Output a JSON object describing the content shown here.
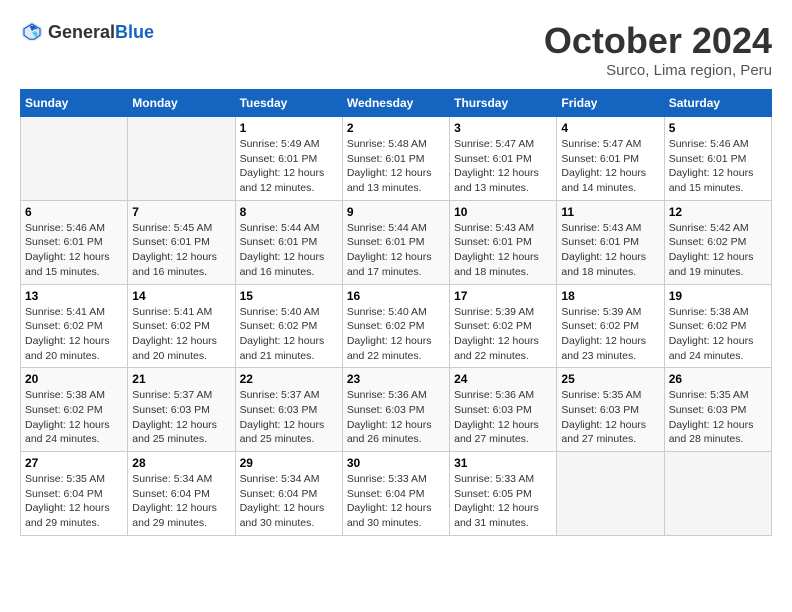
{
  "header": {
    "logo_general": "General",
    "logo_blue": "Blue",
    "month_title": "October 2024",
    "location": "Surco, Lima region, Peru"
  },
  "days_of_week": [
    "Sunday",
    "Monday",
    "Tuesday",
    "Wednesday",
    "Thursday",
    "Friday",
    "Saturday"
  ],
  "weeks": [
    [
      {
        "day": "",
        "info": ""
      },
      {
        "day": "",
        "info": ""
      },
      {
        "day": "1",
        "sunrise": "5:49 AM",
        "sunset": "6:01 PM",
        "daylight": "12 hours and 12 minutes."
      },
      {
        "day": "2",
        "sunrise": "5:48 AM",
        "sunset": "6:01 PM",
        "daylight": "12 hours and 13 minutes."
      },
      {
        "day": "3",
        "sunrise": "5:47 AM",
        "sunset": "6:01 PM",
        "daylight": "12 hours and 13 minutes."
      },
      {
        "day": "4",
        "sunrise": "5:47 AM",
        "sunset": "6:01 PM",
        "daylight": "12 hours and 14 minutes."
      },
      {
        "day": "5",
        "sunrise": "5:46 AM",
        "sunset": "6:01 PM",
        "daylight": "12 hours and 15 minutes."
      }
    ],
    [
      {
        "day": "6",
        "sunrise": "5:46 AM",
        "sunset": "6:01 PM",
        "daylight": "12 hours and 15 minutes."
      },
      {
        "day": "7",
        "sunrise": "5:45 AM",
        "sunset": "6:01 PM",
        "daylight": "12 hours and 16 minutes."
      },
      {
        "day": "8",
        "sunrise": "5:44 AM",
        "sunset": "6:01 PM",
        "daylight": "12 hours and 16 minutes."
      },
      {
        "day": "9",
        "sunrise": "5:44 AM",
        "sunset": "6:01 PM",
        "daylight": "12 hours and 17 minutes."
      },
      {
        "day": "10",
        "sunrise": "5:43 AM",
        "sunset": "6:01 PM",
        "daylight": "12 hours and 18 minutes."
      },
      {
        "day": "11",
        "sunrise": "5:43 AM",
        "sunset": "6:01 PM",
        "daylight": "12 hours and 18 minutes."
      },
      {
        "day": "12",
        "sunrise": "5:42 AM",
        "sunset": "6:02 PM",
        "daylight": "12 hours and 19 minutes."
      }
    ],
    [
      {
        "day": "13",
        "sunrise": "5:41 AM",
        "sunset": "6:02 PM",
        "daylight": "12 hours and 20 minutes."
      },
      {
        "day": "14",
        "sunrise": "5:41 AM",
        "sunset": "6:02 PM",
        "daylight": "12 hours and 20 minutes."
      },
      {
        "day": "15",
        "sunrise": "5:40 AM",
        "sunset": "6:02 PM",
        "daylight": "12 hours and 21 minutes."
      },
      {
        "day": "16",
        "sunrise": "5:40 AM",
        "sunset": "6:02 PM",
        "daylight": "12 hours and 22 minutes."
      },
      {
        "day": "17",
        "sunrise": "5:39 AM",
        "sunset": "6:02 PM",
        "daylight": "12 hours and 22 minutes."
      },
      {
        "day": "18",
        "sunrise": "5:39 AM",
        "sunset": "6:02 PM",
        "daylight": "12 hours and 23 minutes."
      },
      {
        "day": "19",
        "sunrise": "5:38 AM",
        "sunset": "6:02 PM",
        "daylight": "12 hours and 24 minutes."
      }
    ],
    [
      {
        "day": "20",
        "sunrise": "5:38 AM",
        "sunset": "6:02 PM",
        "daylight": "12 hours and 24 minutes."
      },
      {
        "day": "21",
        "sunrise": "5:37 AM",
        "sunset": "6:03 PM",
        "daylight": "12 hours and 25 minutes."
      },
      {
        "day": "22",
        "sunrise": "5:37 AM",
        "sunset": "6:03 PM",
        "daylight": "12 hours and 25 minutes."
      },
      {
        "day": "23",
        "sunrise": "5:36 AM",
        "sunset": "6:03 PM",
        "daylight": "12 hours and 26 minutes."
      },
      {
        "day": "24",
        "sunrise": "5:36 AM",
        "sunset": "6:03 PM",
        "daylight": "12 hours and 27 minutes."
      },
      {
        "day": "25",
        "sunrise": "5:35 AM",
        "sunset": "6:03 PM",
        "daylight": "12 hours and 27 minutes."
      },
      {
        "day": "26",
        "sunrise": "5:35 AM",
        "sunset": "6:03 PM",
        "daylight": "12 hours and 28 minutes."
      }
    ],
    [
      {
        "day": "27",
        "sunrise": "5:35 AM",
        "sunset": "6:04 PM",
        "daylight": "12 hours and 29 minutes."
      },
      {
        "day": "28",
        "sunrise": "5:34 AM",
        "sunset": "6:04 PM",
        "daylight": "12 hours and 29 minutes."
      },
      {
        "day": "29",
        "sunrise": "5:34 AM",
        "sunset": "6:04 PM",
        "daylight": "12 hours and 30 minutes."
      },
      {
        "day": "30",
        "sunrise": "5:33 AM",
        "sunset": "6:04 PM",
        "daylight": "12 hours and 30 minutes."
      },
      {
        "day": "31",
        "sunrise": "5:33 AM",
        "sunset": "6:05 PM",
        "daylight": "12 hours and 31 minutes."
      },
      {
        "day": "",
        "info": ""
      },
      {
        "day": "",
        "info": ""
      }
    ]
  ],
  "labels": {
    "sunrise_prefix": "Sunrise: ",
    "sunset_prefix": "Sunset: ",
    "daylight_prefix": "Daylight: "
  }
}
